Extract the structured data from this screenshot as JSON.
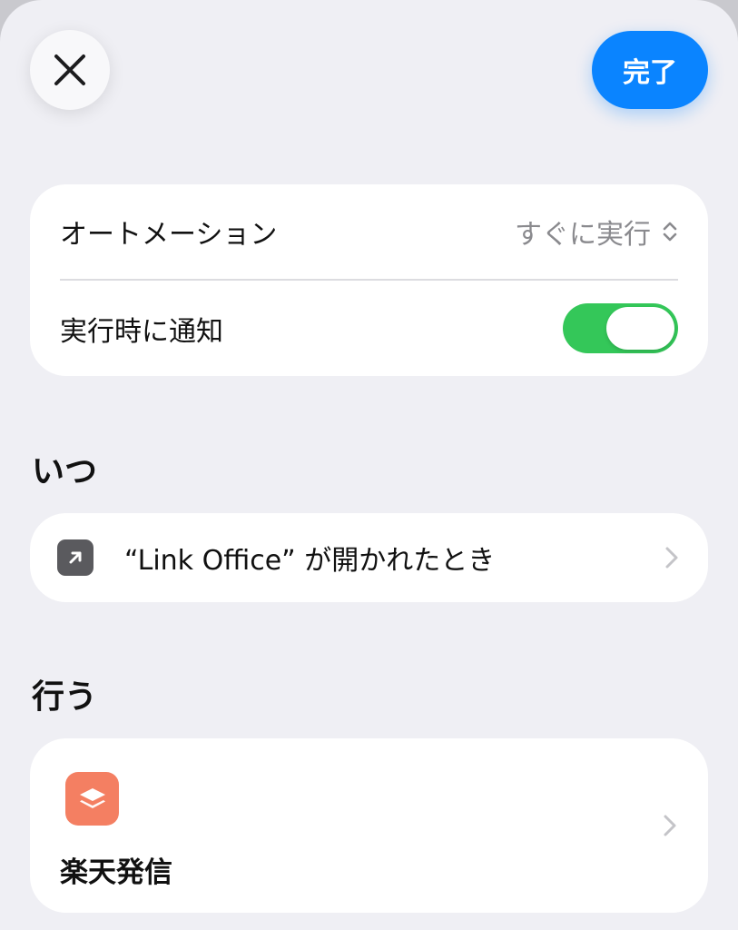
{
  "header": {
    "close_icon": "close-icon",
    "done_label": "完了"
  },
  "settings": {
    "automation_label": "オートメーション",
    "automation_value": "すぐに実行",
    "notify_label": "実行時に通知",
    "notify_enabled": true
  },
  "when": {
    "header": "いつ",
    "trigger_text": "“Link Office” が開かれたとき",
    "trigger_icon": "arrow-up-right-icon"
  },
  "do": {
    "header": "行う",
    "action_label": "楽天発信",
    "action_icon": "shortcuts-layers-icon"
  },
  "colors": {
    "accent": "#0a84ff",
    "toggle_on": "#34c759",
    "action_icon_bg": "#f47f62",
    "background": "#efeff4"
  }
}
